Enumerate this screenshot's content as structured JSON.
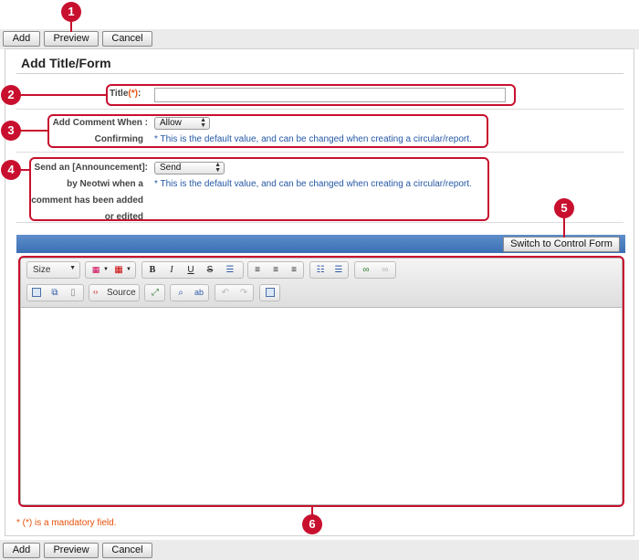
{
  "toolbar": {
    "add": "Add",
    "preview": "Preview",
    "cancel": "Cancel"
  },
  "page": {
    "title": "Add Title/Form",
    "mandatory_note": "* (*) is a mandatory field."
  },
  "form": {
    "title_label": "Title",
    "required_mark": "(*)",
    "title_colon": ":",
    "title_value": "",
    "comment_label_line1": "Add Comment When :",
    "comment_label_line2": "Confirming",
    "comment_value": "Allow",
    "comment_hint": "* This is the default value, and can be changed when creating a circular/report.",
    "announce_label_line1": "Send an [Announcement]:",
    "announce_label_line2": "by Neotwi when a",
    "announce_label_line3": "comment has been added",
    "announce_label_line4": "or edited",
    "announce_value": "Send",
    "announce_hint": "* This is the default value, and can be changed when creating a circular/report."
  },
  "editor": {
    "switch_button": "Switch to Control Form",
    "size_select": "Size",
    "source_button": "Source",
    "icons": {
      "bold": "B",
      "italic": "I",
      "underline": "U",
      "strike": "S"
    }
  },
  "callouts": [
    "1",
    "2",
    "3",
    "4",
    "5",
    "6"
  ],
  "colors": {
    "callout": "#c8102e",
    "hint": "#2458a6",
    "required": "#e8500a",
    "editor_bar": "#3a6fb3"
  }
}
